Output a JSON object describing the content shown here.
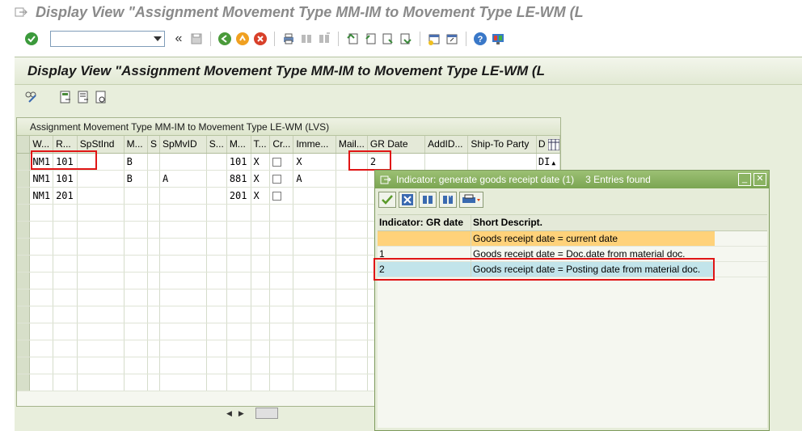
{
  "window": {
    "title": "Display View \"Assignment Movement Type MM-IM to Movement Type LE-WM (L"
  },
  "command_field": {
    "value": "",
    "placeholder": ""
  },
  "main": {
    "header_title": "Display View \"Assignment Movement Type MM-IM to Movement Type LE-WM (L",
    "table": {
      "title": "Assignment Movement Type MM-IM to Movement Type LE-WM (LVS)",
      "columns": [
        "W...",
        "R...",
        "SpStInd",
        "M...",
        "S",
        "SpMvID",
        "S...",
        "M...",
        "T...",
        "Cr...",
        "Imme...",
        "Mail...",
        "GR Date",
        "AddID...",
        "Ship-To Party",
        "D"
      ],
      "rows": [
        {
          "w": "NM1",
          "r": "101",
          "spstind": "",
          "m": "B",
          "s": "",
          "spmvid": "",
          "s2": "",
          "m2": "101",
          "t": "X",
          "cr": false,
          "imme": "X",
          "mail": "",
          "grdate": "2",
          "addid": "",
          "shipto": "",
          "d": "DI"
        },
        {
          "w": "NM1",
          "r": "101",
          "spstind": "",
          "m": "B",
          "s": "",
          "spmvid": "A",
          "s2": "",
          "m2": "881",
          "t": "X",
          "cr": false,
          "imme": "A",
          "mail": "",
          "grdate": "",
          "addid": "",
          "shipto": "",
          "d": ""
        },
        {
          "w": "NM1",
          "r": "201",
          "spstind": "",
          "m": "",
          "s": "",
          "spmvid": "",
          "s2": "",
          "m2": "201",
          "t": "X",
          "cr": false,
          "imme": "",
          "mail": "",
          "grdate": "",
          "addid": "",
          "shipto": "",
          "d": ""
        }
      ]
    }
  },
  "popup": {
    "title": "Indicator: generate goods receipt date (1)",
    "entries_found": "3 Entries found",
    "columns": [
      "Indicator: GR date",
      "Short Descript."
    ],
    "rows": [
      {
        "indicator": "",
        "description": "Goods receipt date = current date"
      },
      {
        "indicator": "1",
        "description": "Goods receipt date = Doc.date from material doc."
      },
      {
        "indicator": "2",
        "description": "Goods receipt date = Posting date from material doc."
      }
    ]
  },
  "colors": {
    "accent_green": "#7ba552",
    "highlight_orange": "#ffd27a",
    "current_row_blue": "#c2e4ea",
    "annotation_red": "#e01515"
  }
}
